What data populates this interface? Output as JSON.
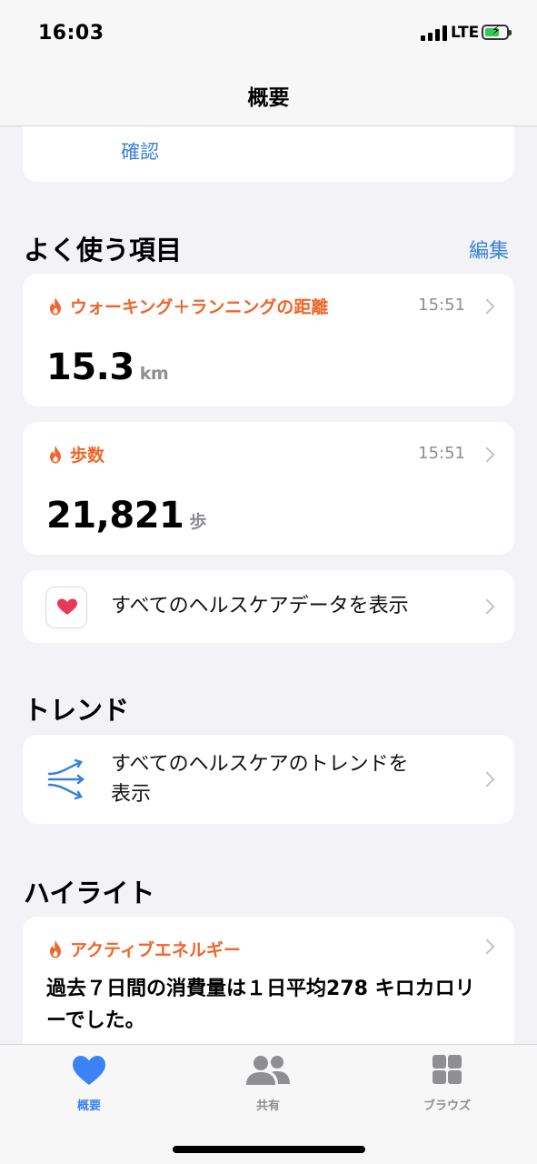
{
  "status_bar": {
    "time": "16:03",
    "network": "LTE"
  },
  "nav": {
    "title": "概要"
  },
  "top_card": {
    "link": "確認"
  },
  "favorites": {
    "title": "よく使う項目",
    "edit": "編集",
    "items": [
      {
        "title": "ウォーキング＋ランニングの距離",
        "time": "15:51",
        "value": "15.3",
        "unit": "km"
      },
      {
        "title": "歩数",
        "time": "15:51",
        "value": "21,821",
        "unit": "歩"
      }
    ],
    "all_data": "すべてのヘルスケアデータを表示"
  },
  "trends": {
    "title": "トレンド",
    "row_line1": "すべてのヘルスケアのトレンドを",
    "row_line2": "表示"
  },
  "highlights": {
    "title": "ハイライト",
    "card_title": "アクティブエネルギー",
    "line1": "過去７日間の消費量は１日平均278 キロカロリ",
    "line2": "ーでした。"
  },
  "tabbar": {
    "tabs": [
      {
        "label": "概要",
        "icon": "heart-icon",
        "active": true
      },
      {
        "label": "共有",
        "icon": "people-icon",
        "active": false
      },
      {
        "label": "ブラウズ",
        "icon": "grid-icon",
        "active": false
      }
    ]
  },
  "colors": {
    "accent": "#3a82d6",
    "orange": "#f0652a",
    "heart": "#e8385a",
    "tab_active": "#3b82f6"
  }
}
